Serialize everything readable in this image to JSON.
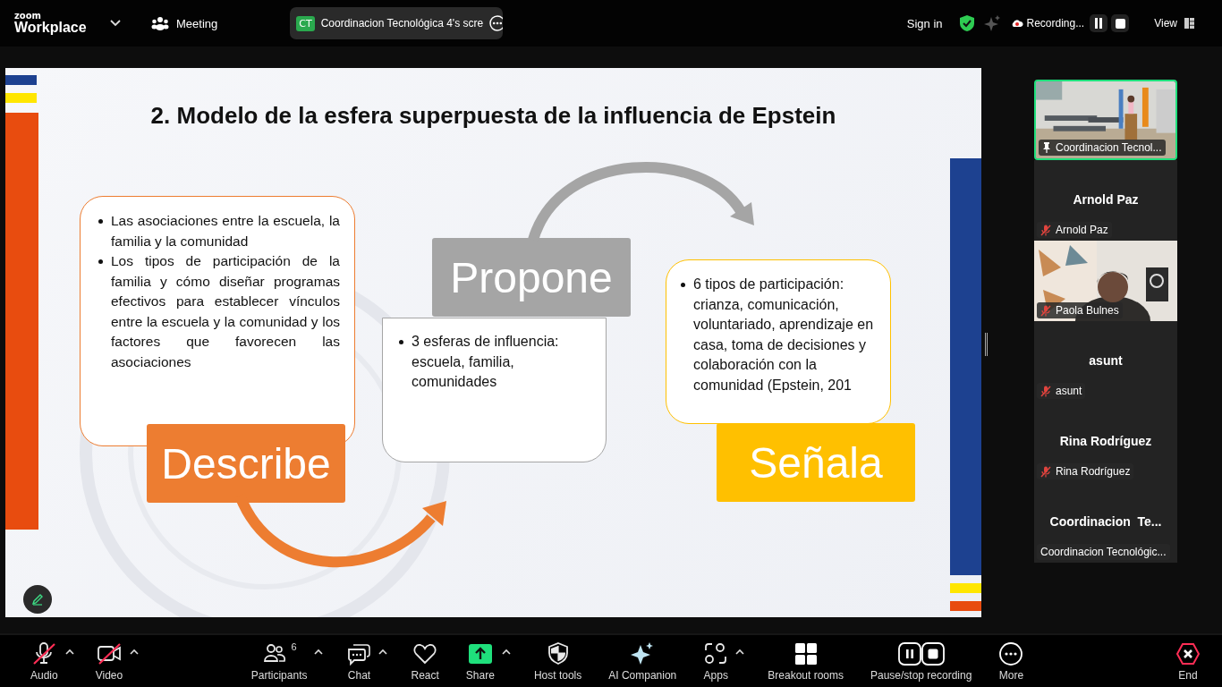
{
  "top_bar": {
    "logo": {
      "small": "zoom",
      "large": "Workplace"
    },
    "meeting_label": "Meeting",
    "share_pill": {
      "initials": "CT",
      "title": "Coordinacion Tecnológica 4's scre"
    },
    "sign_in": "Sign in",
    "recording": {
      "label": "Recording..."
    },
    "view_label": "View"
  },
  "slide": {
    "title": "2. Modelo de la esfera superpuesta de la influencia de Epstein",
    "blocks": [
      {
        "label": "Describe",
        "color": "#ed7d31",
        "bullets": [
          "Las asociaciones entre la escuela, la familia y la comunidad",
          "Los tipos de participación de la familia y cómo diseñar programas efectivos para establecer vínculos entre la escuela y la comunidad y los factores que favorecen las asociaciones"
        ]
      },
      {
        "label": "Propone",
        "color": "#a5a5a5",
        "bullets": [
          "3 esferas de influencia: escuela, familia, comunidades"
        ]
      },
      {
        "label": "Señala",
        "color": "#ffc000",
        "bullets": [
          "6 tipos de participación: crianza, comunicación, voluntariado, aprendizaje en casa, toma de decisiones y colaboración con la comunidad (Epstein, 201"
        ]
      }
    ]
  },
  "participants": [
    {
      "kind": "video",
      "label": "Coordinacion Tecnol...",
      "pinned": true,
      "active": true,
      "muted": false
    },
    {
      "kind": "name",
      "title": "Arnold Paz",
      "label": "Arnold Paz",
      "pinned": false,
      "active": false,
      "muted": true
    },
    {
      "kind": "video",
      "label": "Paola Bulnes",
      "pinned": false,
      "active": false,
      "muted": true
    },
    {
      "kind": "name",
      "title": "asunt",
      "label": "asunt",
      "pinned": false,
      "active": false,
      "muted": true
    },
    {
      "kind": "name",
      "title": "Rina Rodríguez",
      "label": "Rina Rodríguez",
      "pinned": false,
      "active": false,
      "muted": true
    },
    {
      "kind": "name",
      "title": "Coordinacion  Te...",
      "label": "Coordinacion Tecnológic...",
      "pinned": false,
      "active": false,
      "muted": false
    }
  ],
  "toolbar": [
    {
      "kind": "audio",
      "label": "Audio",
      "off": true,
      "caret": true
    },
    {
      "kind": "video",
      "label": "Video",
      "off": true,
      "caret": true
    },
    {
      "kind": "participants",
      "label": "Participants",
      "count": "6",
      "caret": true
    },
    {
      "kind": "chat",
      "label": "Chat",
      "caret": true
    },
    {
      "kind": "react",
      "label": "React",
      "caret": false
    },
    {
      "kind": "share",
      "label": "Share",
      "caret": true
    },
    {
      "kind": "host",
      "label": "Host tools",
      "caret": false
    },
    {
      "kind": "ai",
      "label": "AI Companion",
      "caret": false
    },
    {
      "kind": "apps",
      "label": "Apps",
      "caret": true
    },
    {
      "kind": "breakout",
      "label": "Breakout rooms",
      "caret": false
    },
    {
      "kind": "recording",
      "label": "Pause/stop recording",
      "caret": false
    },
    {
      "kind": "more",
      "label": "More",
      "caret": false
    },
    {
      "kind": "end",
      "label": "End",
      "caret": false
    }
  ]
}
